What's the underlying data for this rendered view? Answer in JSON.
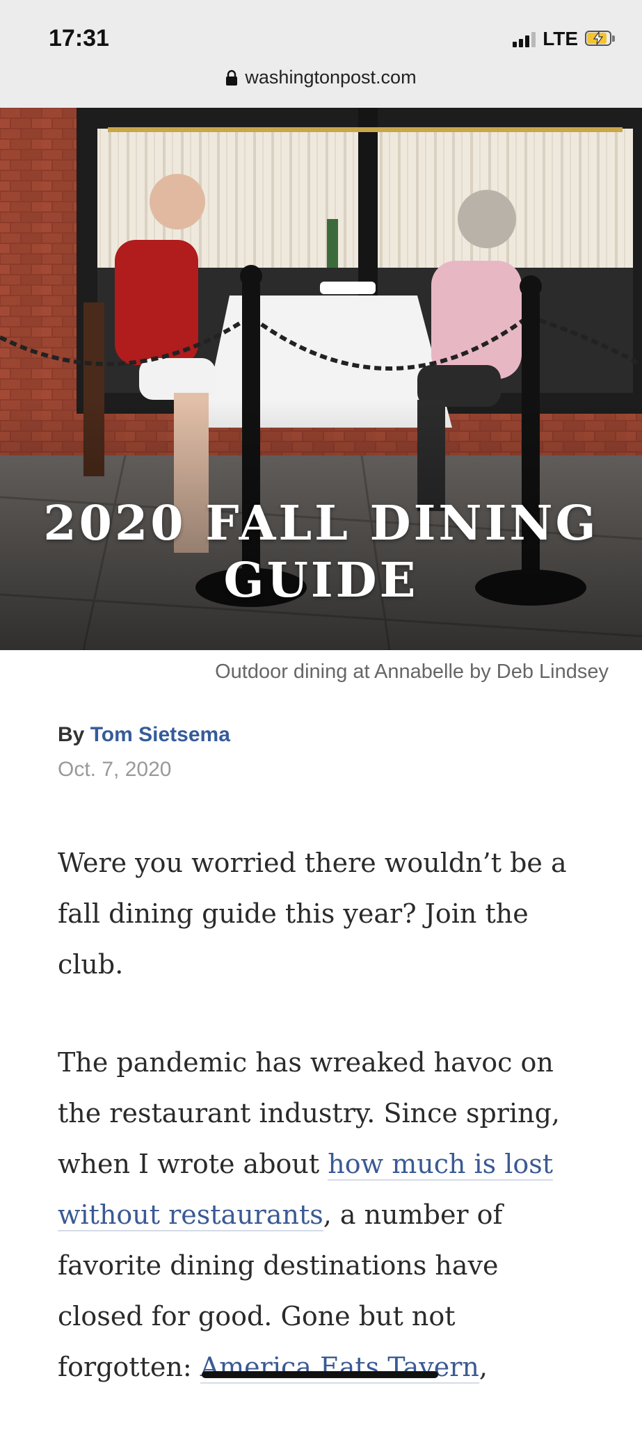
{
  "status_bar": {
    "time": "17:31",
    "network": "LTE"
  },
  "browser": {
    "url": "washingtonpost.com"
  },
  "hero": {
    "title_line1": "2020 FALL DINING",
    "title_line2": "GUIDE",
    "caption": "Outdoor dining at Annabelle by Deb Lindsey"
  },
  "byline": {
    "prefix": "By",
    "author": "Tom Sietsema",
    "date": "Oct. 7, 2020"
  },
  "article": {
    "p1": "Were you worried there wouldn’t be a fall dining guide this year? Join the club.",
    "p2_before": "The pandemic has wreaked havoc on the restaurant industry. Since spring, when I wrote about ",
    "p2_link1": "how much is lost without restaurants",
    "p2_middle": ", a number of favorite dining destinations have closed for good. Gone but not forgotten: ",
    "p2_link2": "America Eats Tavern",
    "p2_after": ","
  },
  "colors": {
    "link": "#3a5a94",
    "author": "#355b9a",
    "battery": "#f4c430"
  }
}
